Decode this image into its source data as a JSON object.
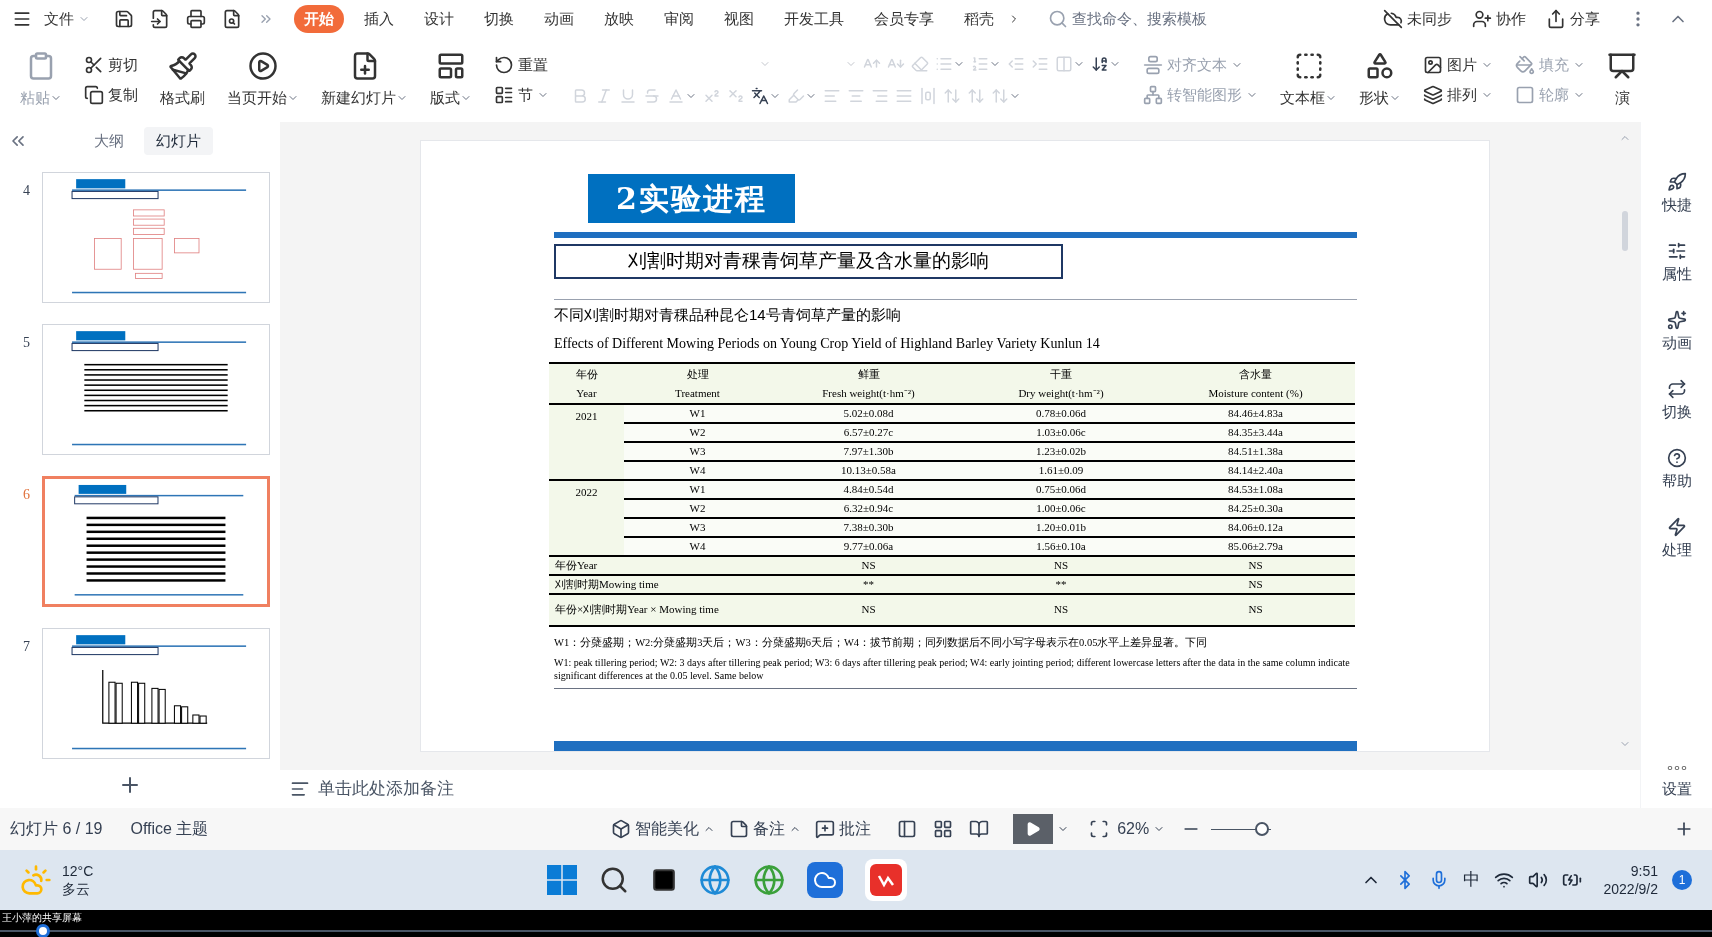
{
  "menu": {
    "file": "文件",
    "tabs": [
      {
        "label": "开始",
        "selected": true
      },
      {
        "label": "插入",
        "selected": false
      },
      {
        "label": "设计",
        "selected": false
      },
      {
        "label": "切换",
        "selected": false
      },
      {
        "label": "动画",
        "selected": false
      },
      {
        "label": "放映",
        "selected": false
      },
      {
        "label": "审阅",
        "selected": false
      },
      {
        "label": "视图",
        "selected": false
      },
      {
        "label": "开发工具",
        "selected": false
      },
      {
        "label": "会员专享",
        "selected": false
      },
      {
        "label": "稻壳",
        "selected": false
      }
    ],
    "search": {
      "placeholder": "查找命令、搜索模板"
    },
    "actions": [
      {
        "kind": "sync",
        "label": "未同步"
      },
      {
        "kind": "collab",
        "label": "协作"
      },
      {
        "kind": "share",
        "label": "分享"
      }
    ]
  },
  "ribbon": [
    {
      "kind": "big",
      "label": "粘贴",
      "dropdown": true,
      "disabled": true
    },
    {
      "kind": "stack",
      "items": [
        {
          "label": "剪切",
          "dropdown": false,
          "disabled": false
        },
        {
          "label": "复制",
          "dropdown": false,
          "disabled": false
        }
      ]
    },
    {
      "kind": "big",
      "label": "格式刷",
      "dropdown": false,
      "disabled": false
    },
    {
      "kind": "big",
      "label": "当页开始",
      "dropdown": true,
      "disabled": false
    },
    {
      "kind": "big",
      "label": "新建幻灯片",
      "dropdown": true,
      "disabled": false
    },
    {
      "kind": "big",
      "label": "版式",
      "dropdown": true,
      "disabled": false
    },
    {
      "kind": "stack",
      "items": [
        {
          "label": "重置",
          "dropdown": false,
          "disabled": false
        },
        {
          "label": "节",
          "dropdown": true,
          "disabled": false
        }
      ]
    },
    {
      "kind": "tools",
      "rows": [
        [
          {
            "kind": "font-field",
            "dropdown": true,
            "disabled": true
          },
          {
            "kind": "size-field",
            "dropdown": true,
            "disabled": true
          },
          {
            "kind": "grow",
            "dropdown": false,
            "disabled": true
          },
          {
            "kind": "shrink",
            "dropdown": false,
            "disabled": true
          },
          {
            "kind": "clear",
            "dropdown": false,
            "disabled": true
          },
          {
            "kind": "bullets",
            "dropdown": true,
            "disabled": true
          },
          {
            "kind": "numbering",
            "dropdown": true,
            "disabled": true
          },
          {
            "kind": "outdent",
            "dropdown": false,
            "disabled": true
          },
          {
            "kind": "indent",
            "dropdown": false,
            "disabled": true
          },
          {
            "kind": "direction",
            "dropdown": true,
            "disabled": true
          },
          {
            "kind": "sort",
            "dropdown": true,
            "disabled": false
          }
        ],
        [
          {
            "kind": "bold",
            "dropdown": false,
            "disabled": true
          },
          {
            "kind": "italic",
            "dropdown": false,
            "disabled": true
          },
          {
            "kind": "underline",
            "dropdown": false,
            "disabled": true
          },
          {
            "kind": "strike",
            "dropdown": false,
            "disabled": true
          },
          {
            "kind": "color",
            "dropdown": true,
            "disabled": true
          },
          {
            "kind": "sup",
            "dropdown": false,
            "disabled": true
          },
          {
            "kind": "sub",
            "dropdown": false,
            "disabled": true
          },
          {
            "kind": "pinyin",
            "dropdown": true,
            "disabled": false
          },
          {
            "kind": "highlight",
            "dropdown": true,
            "disabled": true
          },
          {
            "kind": "left",
            "dropdown": false,
            "disabled": true
          },
          {
            "kind": "center",
            "dropdown": false,
            "disabled": true
          },
          {
            "kind": "right",
            "dropdown": false,
            "disabled": true
          },
          {
            "kind": "justify",
            "dropdown": false,
            "disabled": true
          },
          {
            "kind": "distribute",
            "dropdown": false,
            "disabled": true
          },
          {
            "kind": "spacing",
            "dropdown": false,
            "disabled": true
          },
          {
            "kind": "spacing",
            "dropdown": false,
            "disabled": true
          },
          {
            "kind": "spacing",
            "dropdown": true,
            "disabled": true
          }
        ]
      ]
    },
    {
      "kind": "stack",
      "items": [
        {
          "label": "对齐文本",
          "dropdown": true,
          "disabled": true
        },
        {
          "label": "转智能图形",
          "dropdown": true,
          "disabled": true
        }
      ]
    },
    {
      "kind": "big",
      "label": "文本框",
      "dropdown": true,
      "disabled": false
    },
    {
      "kind": "big",
      "label": "形状",
      "dropdown": true,
      "disabled": false
    },
    {
      "kind": "stack",
      "items": [
        {
          "label": "图片",
          "dropdown": true,
          "disabled": false
        },
        {
          "label": "排列",
          "dropdown": true,
          "disabled": false
        }
      ]
    },
    {
      "kind": "stack",
      "items": [
        {
          "label": "填充",
          "dropdown": true,
          "disabled": true
        },
        {
          "label": "轮廓",
          "dropdown": true,
          "disabled": true
        }
      ]
    },
    {
      "kind": "big",
      "label": "演",
      "dropdown": false,
      "disabled": false
    }
  ],
  "left_panel": {
    "tabs": [
      {
        "label": "大纲",
        "selected": false
      },
      {
        "label": "幻灯片",
        "selected": true
      }
    ],
    "slides": [
      {
        "number": "4",
        "kind": "diagram",
        "selected": false
      },
      {
        "number": "5",
        "kind": "table",
        "selected": false
      },
      {
        "number": "6",
        "kind": "table",
        "selected": true
      },
      {
        "number": "7",
        "kind": "chart",
        "selected": false
      }
    ]
  },
  "slide": {
    "heading": "2实验进程",
    "subtitle": "刈割时期对青稞青饲草产量及含水量的影响",
    "table_title": "不同刈割时期对青稞品种昆仑14号青饲草产量的影响",
    "table_title_en": "Effects of Different Mowing Periods on Young Crop Yield of Highland Barley Variety Kunlun 14",
    "table": {
      "columns": [
        {
          "zh": "年份",
          "en": "Year"
        },
        {
          "zh": "处理",
          "en": "Treatment"
        },
        {
          "zh": "鲜重",
          "en": "Fresh weight(t·hm⁻²)"
        },
        {
          "zh": "干重",
          "en": "Dry weight(t·hm⁻²)"
        },
        {
          "zh": "含水量",
          "en": "Moisture content (%)"
        }
      ],
      "groups": [
        {
          "year": "2021",
          "rows": [
            [
              "W1",
              "5.02±0.08d",
              "0.78±0.06d",
              "84.46±4.83a"
            ],
            [
              "W2",
              "6.57±0.27c",
              "1.03±0.06c",
              "84.35±3.44a"
            ],
            [
              "W3",
              "7.97±1.30b",
              "1.23±0.02b",
              "84.51±1.38a"
            ],
            [
              "W4",
              "10.13±0.58a",
              "1.61±0.09",
              "84.14±2.40a"
            ]
          ]
        },
        {
          "year": "2022",
          "rows": [
            [
              "W1",
              "4.84±0.54d",
              "0.75±0.06d",
              "84.53±1.08a"
            ],
            [
              "W2",
              "6.32±0.94c",
              "1.00±0.06c",
              "84.25±0.30a"
            ],
            [
              "W3",
              "7.38±0.30b",
              "1.20±0.01b",
              "84.06±0.12a"
            ],
            [
              "W4",
              "9.77±0.06a",
              "1.56±0.10a",
              "85.06±2.79a"
            ]
          ]
        }
      ],
      "stats": [
        [
          "年份Year",
          "NS",
          "NS",
          "NS"
        ],
        [
          "刈割时期Mowing time",
          "**",
          "**",
          "NS"
        ],
        [
          "年份×刈割时期Year × Mowing time",
          "NS",
          "NS",
          "NS"
        ]
      ]
    },
    "notes": [
      "W1：分蘖盛期；W2:分蘖盛期3天后；W3：分蘖盛期6天后；W4：拔节前期；同列数据后不同小写字母表示在0.05水平上差异显著。下同",
      "W1: peak tillering period; W2: 3 days after tillering peak period; W3: 6 days after tillering peak period; W4: early jointing period; different lowercase letters after the data in the same column indicate significant differences at the 0.05 level. Same below"
    ]
  },
  "right_sidebar": [
    {
      "kind": "quick",
      "label": "快捷"
    },
    {
      "kind": "props",
      "label": "属性"
    },
    {
      "kind": "anim",
      "label": "动画"
    },
    {
      "kind": "switch",
      "label": "切换"
    },
    {
      "kind": "help",
      "label": "帮助"
    },
    {
      "kind": "process",
      "label": "处理"
    }
  ],
  "settings": "设置",
  "notes_placeholder": "单击此处添加备注",
  "status_bar": {
    "slide_counter": "幻灯片 6 / 19",
    "theme": "Office 主题",
    "buttons": [
      {
        "kind": "beautify",
        "label": "智能美化",
        "dropdown": true
      },
      {
        "kind": "notes",
        "label": "备注",
        "dropdown": true
      },
      {
        "kind": "comment",
        "label": "批注",
        "dropdown": false
      }
    ],
    "zoom": "62%",
    "zoom_slider": {
      "level": 0.85
    }
  },
  "taskbar": {
    "temperature": "12°C",
    "weather": "多云",
    "ime": "中",
    "time": "9:51",
    "date": "2022/9/2",
    "badge": "1"
  },
  "share_label": "王小萍的共享屏幕",
  "playback": {
    "level": 0.025
  }
}
